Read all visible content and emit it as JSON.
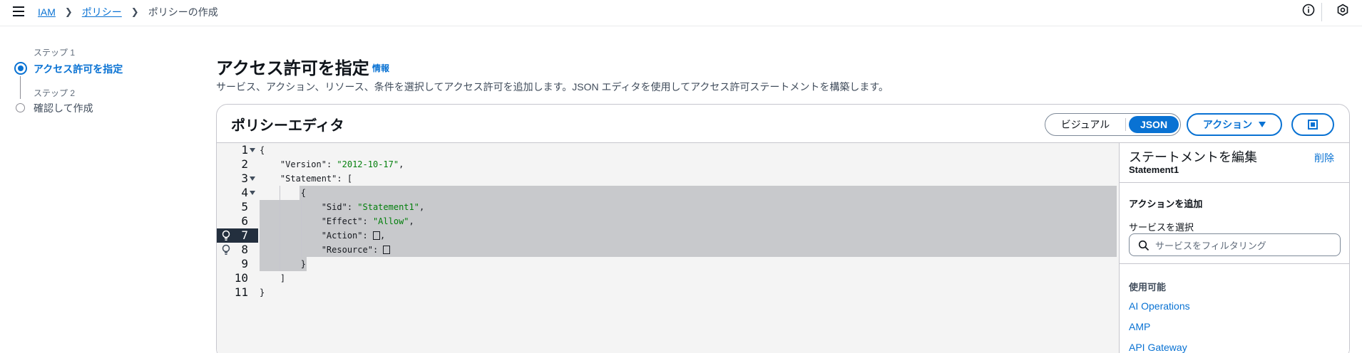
{
  "breadcrumb": {
    "items": [
      "IAM",
      "ポリシー"
    ],
    "current": "ポリシーの作成"
  },
  "steps": [
    {
      "sub": "ステップ 1",
      "label": "アクセス許可を指定",
      "active": true
    },
    {
      "sub": "ステップ 2",
      "label": "確認して作成",
      "active": false
    }
  ],
  "page": {
    "title": "アクセス許可を指定",
    "info_link": "情報",
    "description": "サービス、アクション、リソース、条件を選択してアクセス許可を追加します。JSON エディタを使用してアクセス許可ステートメントを構築します。"
  },
  "editor": {
    "title": "ポリシーエディタ",
    "mode_visual": "ビジュアル",
    "mode_json": "JSON",
    "actions_label": "アクション",
    "line_numbers": [
      "1",
      "2",
      "3",
      "4",
      "5",
      "6",
      "7",
      "8",
      "9",
      "10",
      "11"
    ],
    "code": {
      "l1": "{",
      "l2_key": "\"Version\"",
      "l2_val": "\"2012-10-17\"",
      "l3_key": "\"Statement\"",
      "l4": "{",
      "l5_key": "\"Sid\"",
      "l5_val": "\"Statement1\"",
      "l6_key": "\"Effect\"",
      "l6_val": "\"Allow\"",
      "l7_key": "\"Action\"",
      "l8_key": "\"Resource\"",
      "l9": "}",
      "l10": "]",
      "l11": "}"
    }
  },
  "statement_panel": {
    "title": "ステートメントを編集",
    "delete_label": "削除",
    "statement_name": "Statement1",
    "add_action_label": "アクションを追加",
    "select_service_label": "サービスを選択",
    "filter_placeholder": "サービスをフィルタリング",
    "available_label": "使用可能",
    "services": [
      "AI Operations",
      "AMP",
      "API Gateway"
    ]
  },
  "colors": {
    "accent": "#0972d3",
    "string": "#037f0c",
    "active_line": "#232f3e",
    "selection": "#c8c9cc"
  },
  "icons": [
    "menu-icon",
    "info-icon",
    "settings-icon",
    "fold-arrow-icon",
    "lightbulb-icon",
    "search-icon",
    "fullscreen-icon",
    "caret-down-icon"
  ]
}
